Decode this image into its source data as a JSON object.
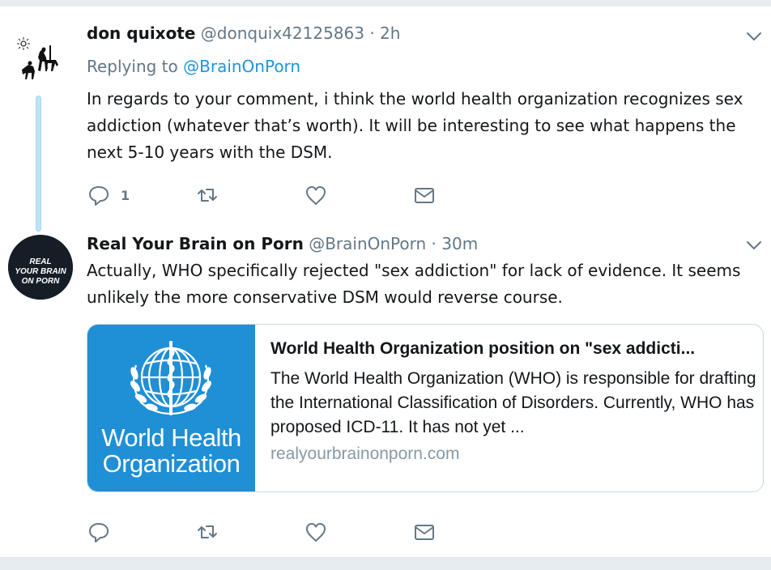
{
  "tweets": [
    {
      "name": "don quixote",
      "handle": "@donquix42125863",
      "time": "· 2h",
      "replying_prefix": "Replying to",
      "replying_to": "@BrainOnPorn",
      "body": "In regards to your comment, i think the world health organization recognizes sex addiction (whatever that’s worth). It will be interesting to see what happens the next 5-10 years with the DSM.",
      "reply_count": "1",
      "avatar_icon": "don-quixote-silhouette"
    },
    {
      "name": "Real Your Brain on Porn",
      "handle": "@BrainOnPorn",
      "time": "· 30m",
      "body": "Actually, WHO specifically rejected \"sex addiction\" for lack of evidence. It seems unlikely the more conservative DSM would reverse course.",
      "avatar_lines": [
        "REAL",
        "YOUR BRAIN",
        "ON PORN"
      ],
      "card": {
        "title": "World Health Organization position on \"sex addicti...",
        "description": "The World Health Organization (WHO) is responsible for drafting the International Classification of Disorders. Currently, WHO has proposed ICD-11. It has not yet ...",
        "domain": "realyourbrainonporn.com",
        "image_text_1": "World Health",
        "image_text_2": "Organization",
        "image_color": "#1f8fd6"
      }
    }
  ],
  "colors": {
    "link": "#1b95e0",
    "muted": "#657786",
    "thread_line": "#bfe3f4"
  }
}
